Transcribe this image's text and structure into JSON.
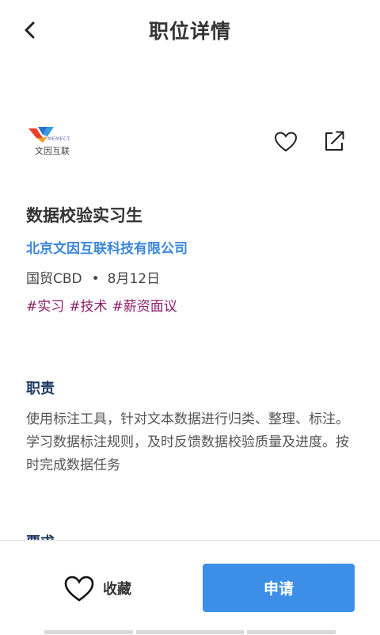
{
  "header": {
    "title": "职位详情"
  },
  "company_logo": {
    "text": "文因互联",
    "sub": "MEMECT"
  },
  "job": {
    "title": "数据校验实习生",
    "company": "北京文因互联科技有限公司",
    "location": "国贸CBD",
    "separator": "•",
    "date": "8月12日",
    "tags": [
      "#实习",
      "#技术",
      "#薪资面议"
    ]
  },
  "sections": {
    "duties_title": "职责",
    "duties_text": "使用标注工具，针对文本数据进行归类、整理、标注。学习数据标注规则，及时反馈数据校验质量及进度。按时完成数据任务",
    "next_title": "要求"
  },
  "bottom": {
    "favorite_label": "收藏",
    "apply_label": "申请"
  },
  "colors": {
    "accent": "#3d8ee6",
    "company_link": "#3b87d8",
    "tag": "#8b1c6b",
    "section_title": "#1f3b63"
  }
}
